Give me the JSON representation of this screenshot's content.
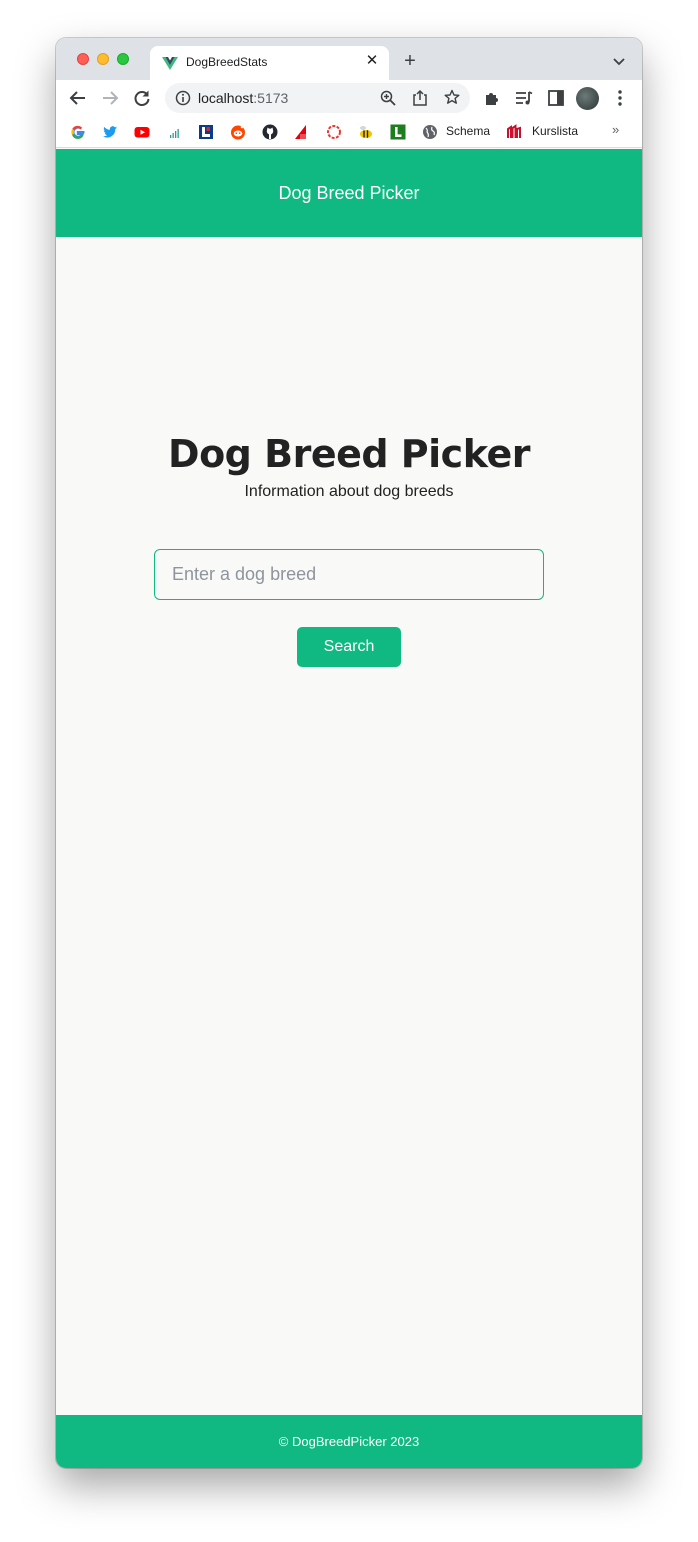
{
  "browser": {
    "tab": {
      "title": "DogBreedStats",
      "favicon": "vue-logo-icon"
    },
    "url": {
      "host": "localhost",
      "port": ":5173"
    },
    "bookmarks": [
      {
        "icon": "google-icon"
      },
      {
        "icon": "twitter-icon"
      },
      {
        "icon": "youtube-icon"
      },
      {
        "icon": "stats-icon"
      },
      {
        "icon": "l-square-icon"
      },
      {
        "icon": "reddit-icon"
      },
      {
        "icon": "github-icon"
      },
      {
        "icon": "csn-icon"
      },
      {
        "icon": "ring-icon"
      },
      {
        "icon": "bee-icon"
      },
      {
        "icon": "l-green-icon"
      },
      {
        "icon": "globe-icon",
        "label": "Schema"
      },
      {
        "icon": "m-logo-icon",
        "label": "Kurslista"
      }
    ],
    "more": "»"
  },
  "app": {
    "header_title": "Dog Breed Picker",
    "hero_title": "Dog Breed Picker",
    "hero_subtitle": "Information about dog breeds",
    "search_placeholder": "Enter a dog breed",
    "search_button": "Search",
    "footer": "© DogBreedPicker 2023"
  },
  "colors": {
    "accent": "#10b981",
    "background": "#f9f9f8",
    "text": "#222222"
  }
}
